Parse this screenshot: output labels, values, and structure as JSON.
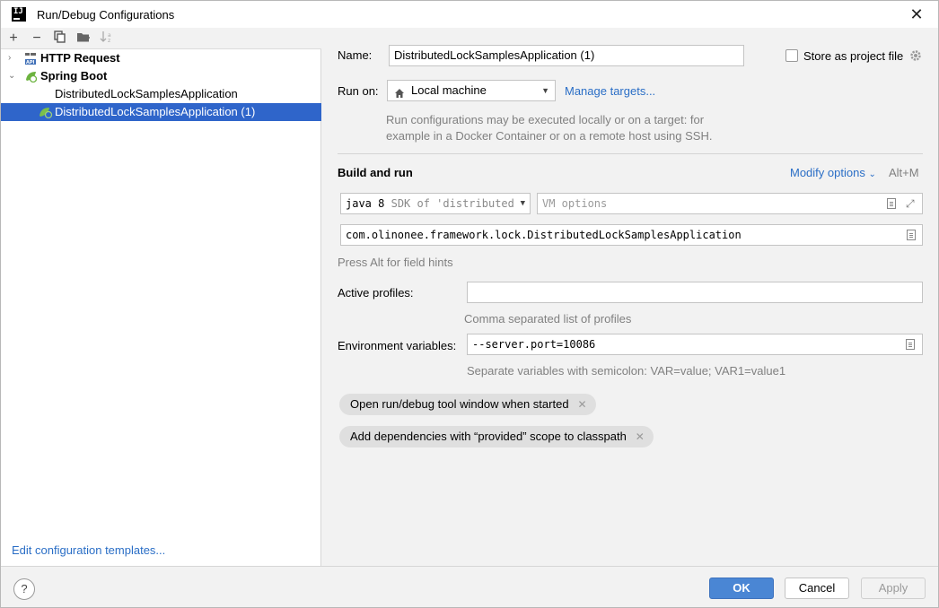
{
  "window": {
    "title": "Run/Debug Configurations",
    "logo_text": "IJ"
  },
  "left_panel": {
    "toolbar": [
      {
        "icon": "add-icon",
        "glyph": "+"
      },
      {
        "icon": "remove-icon",
        "glyph": "−"
      },
      {
        "icon": "copy-icon",
        "glyph": "⧉"
      },
      {
        "icon": "folder-icon",
        "glyph": "▰"
      },
      {
        "icon": "sort-icon",
        "glyph": "↓"
      }
    ],
    "tree": [
      {
        "label": "HTTP Request",
        "bold": true,
        "expandable": true,
        "expanded": false,
        "icon": "http-api-icon"
      },
      {
        "label": "Spring Boot",
        "bold": true,
        "expandable": true,
        "expanded": true,
        "icon": "spring-boot-icon"
      },
      {
        "label": "DistributedLockSamplesApplication",
        "bold": false,
        "icon": ""
      },
      {
        "label": "DistributedLockSamplesApplication (1)",
        "bold": false,
        "selected": true,
        "icon": "spring-boot-run-icon"
      }
    ],
    "edit_templates_link": "Edit configuration templates..."
  },
  "form": {
    "name_label": "Name:",
    "name_value": "DistributedLockSamplesApplication (1)",
    "store_as_project_file": "Store as project file",
    "run_on_label": "Run on:",
    "run_on_value": "Local machine",
    "manage_targets": "Manage targets...",
    "run_on_hint_line1": "Run configurations may be executed locally or on a target: for",
    "run_on_hint_line2": "example in a Docker Container or on a remote host using SSH.",
    "build_and_run_title": "Build and run",
    "modify_options": "Modify options",
    "modify_options_shortcut": "Alt+M",
    "jre_value": "java 8",
    "jre_detail": "SDK of 'distributed",
    "vm_options_placeholder": "VM options",
    "main_class_value": "com.olinonee.framework.lock.DistributedLockSamplesApplication",
    "field_hints": "Press Alt for field hints",
    "active_profiles_label": "Active profiles:",
    "active_profiles_value": "",
    "active_profiles_hint": "Comma separated list of profiles",
    "env_vars_label": "Environment variables:",
    "env_vars_value": "--server.port=10086",
    "env_vars_hint": "Separate variables with semicolon: VAR=value; VAR1=value1",
    "chips": [
      "Open run/debug tool window when started",
      "Add dependencies with “provided” scope to classpath"
    ]
  },
  "footer": {
    "help": "?",
    "ok": "OK",
    "cancel": "Cancel",
    "apply": "Apply"
  },
  "colors": {
    "selection": "#2f65ca",
    "link": "#2a6ec6",
    "primary_button": "#4a86d4"
  }
}
